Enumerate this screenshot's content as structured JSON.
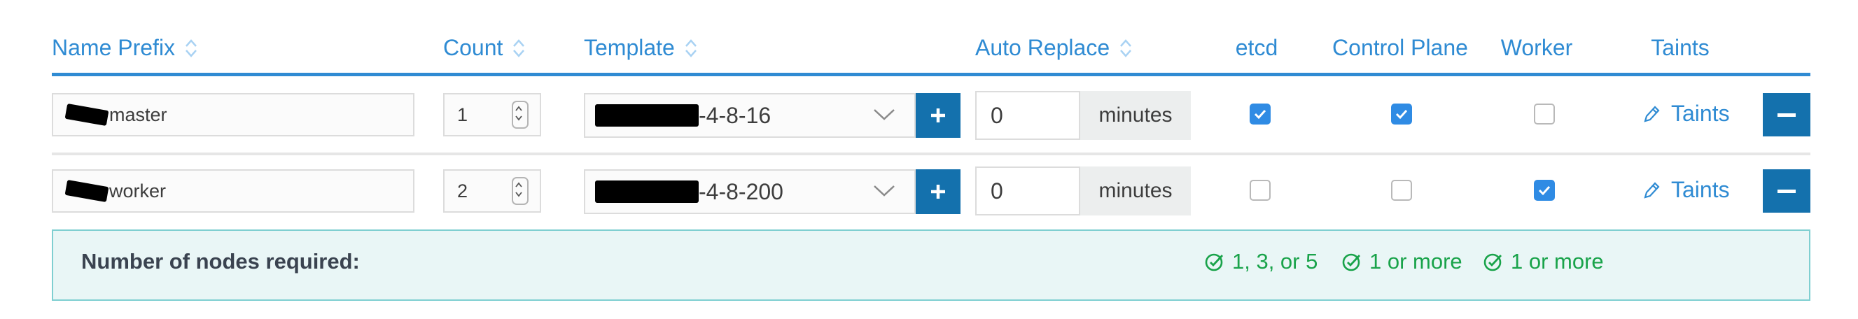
{
  "columns": {
    "name_prefix": "Name Prefix",
    "count": "Count",
    "template": "Template",
    "auto_replace": "Auto Replace",
    "etcd": "etcd",
    "control_plane": "Control Plane",
    "worker": "Worker",
    "taints": "Taints"
  },
  "rows": [
    {
      "name_prefix": "master",
      "count": "1",
      "template_suffix": "-4-8-16",
      "auto_replace": "0",
      "auto_replace_unit": "minutes",
      "etcd": true,
      "control_plane": true,
      "worker": false,
      "taints_label": "Taints"
    },
    {
      "name_prefix": "worker",
      "count": "2",
      "template_suffix": "-4-8-200",
      "auto_replace": "0",
      "auto_replace_unit": "minutes",
      "etcd": false,
      "control_plane": false,
      "worker": true,
      "taints_label": "Taints"
    }
  ],
  "summary": {
    "label": "Number of nodes required:",
    "etcd_requirement": "1, 3, or 5",
    "control_plane_requirement": "1 or more",
    "worker_requirement": "1 or more"
  },
  "icons": {
    "sort": "sort-icon",
    "chevron": "chevron-down-icon",
    "plus": "plus-icon",
    "pencil": "pencil-icon",
    "minus": "minus-icon",
    "check_circle": "check-circle-icon"
  },
  "colors": {
    "accent": "#2f8bd3",
    "button": "#1471ad",
    "checkbox": "#2f8be4",
    "success": "#19a34a",
    "summary_bg": "#e9f6f6"
  }
}
